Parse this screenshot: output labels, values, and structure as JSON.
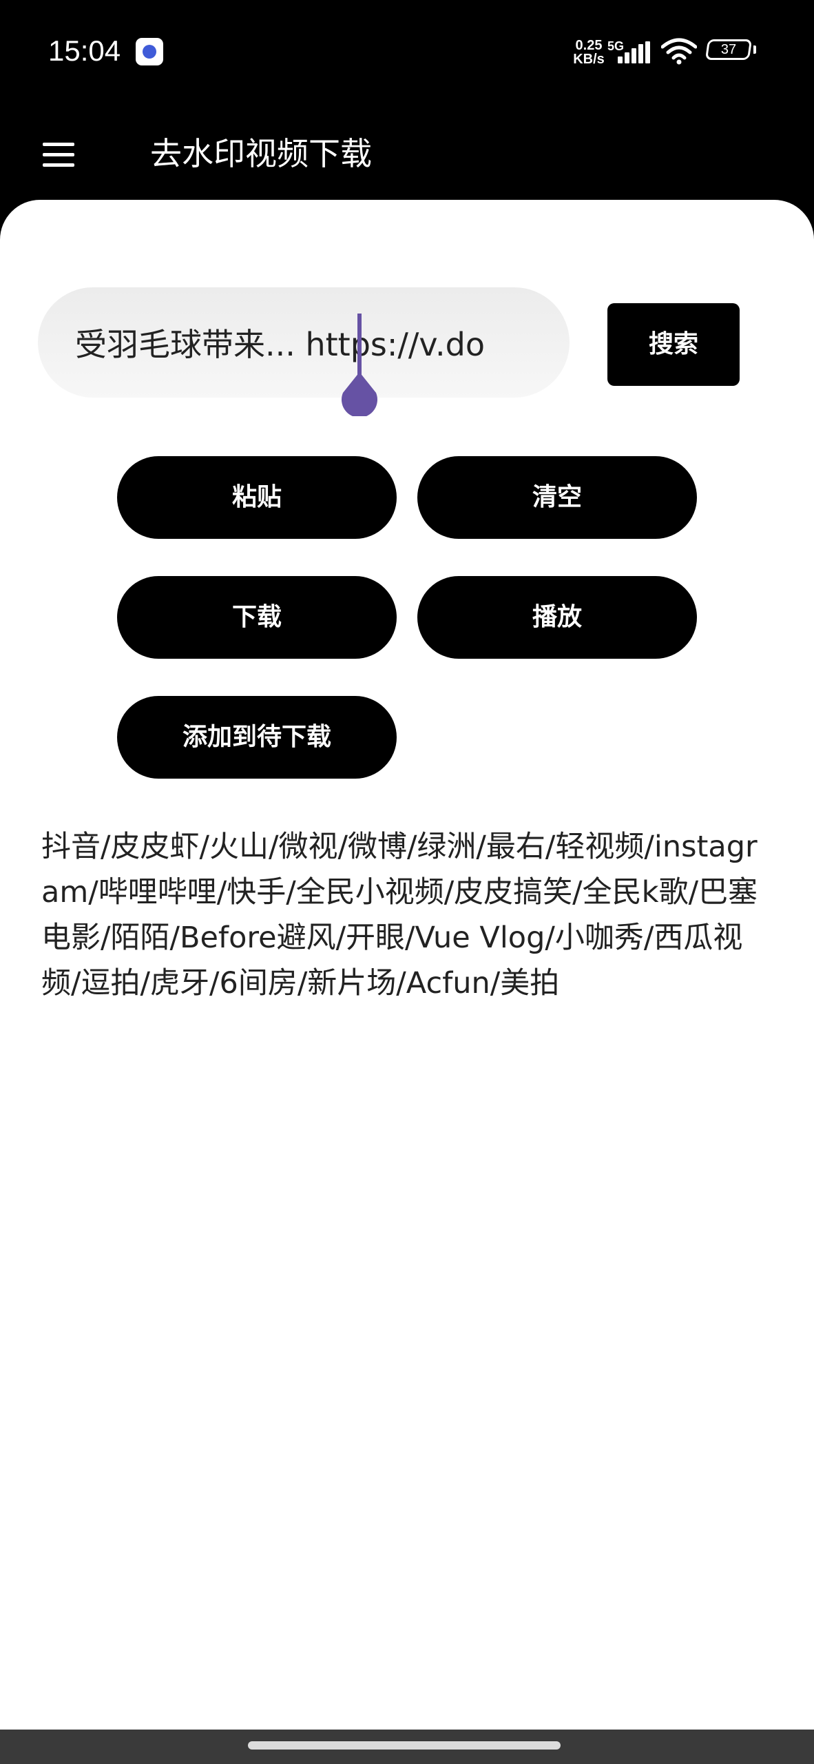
{
  "status_bar": {
    "time": "15:04",
    "app_icon": "app-notification-icon",
    "net_speed_value": "0.25",
    "net_speed_unit": "KB/s",
    "network_type": "5G",
    "battery_level": "37"
  },
  "app_bar": {
    "menu_icon": "hamburger-menu-icon",
    "title": "去水印视频下载"
  },
  "search": {
    "value": "受羽毛球带来... https://v.do",
    "button_label": "搜索"
  },
  "actions": {
    "paste_label": "粘贴",
    "clear_label": "清空",
    "download_label": "下载",
    "play_label": "播放",
    "add_queue_label": "添加到待下载"
  },
  "supported_platforms": "抖音/皮皮虾/火山/微视/微博/绿洲/最右/轻视频/instagram/哔哩哔哩/快手/全民小视频/皮皮搞笑/全民k歌/巴塞电影/陌陌/Before避风/开眼/Vue Vlog/小咖秀/西瓜视频/逗拍/虎牙/6间房/新片场/Acfun/美拍",
  "colors": {
    "background_dark": "#000000",
    "card": "#ffffff",
    "button": "#000000",
    "cursor_accent": "#6652a4",
    "nav_bar": "#3a3a3a"
  }
}
